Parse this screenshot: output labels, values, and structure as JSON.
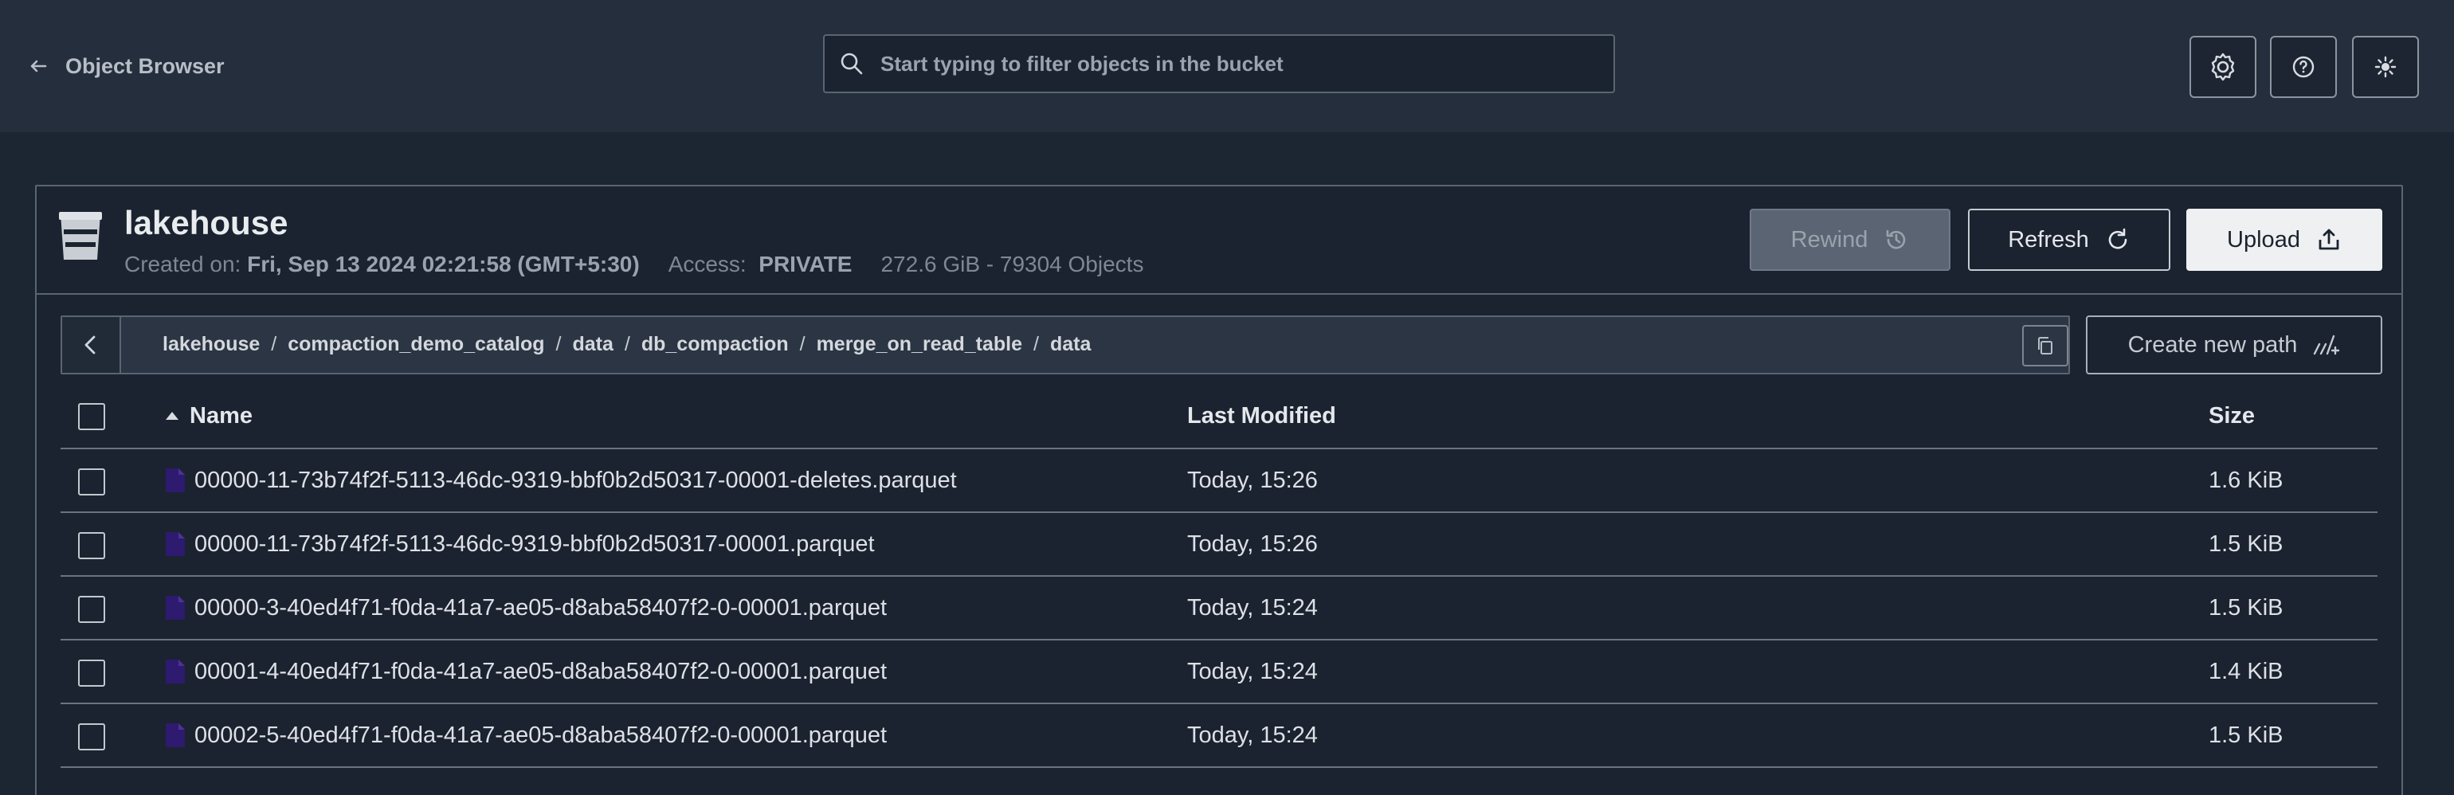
{
  "header": {
    "back_label": "Object Browser",
    "search_placeholder": "Start typing to filter objects in the bucket",
    "icons": [
      "settings-icon",
      "help-icon",
      "theme-toggle-icon"
    ]
  },
  "bucket": {
    "name": "lakehouse",
    "created_label": "Created on:",
    "created_value": "Fri, Sep 13 2024 02:21:58 (GMT+5:30)",
    "access_label": "Access:",
    "access_value": "PRIVATE",
    "usage": "272.6 GiB - 79304 Objects"
  },
  "actions": {
    "rewind": "Rewind",
    "refresh": "Refresh",
    "upload": "Upload",
    "create_path": "Create new path"
  },
  "breadcrumb": [
    "lakehouse",
    "compaction_demo_catalog",
    "data",
    "db_compaction",
    "merge_on_read_table",
    "data"
  ],
  "table": {
    "columns": {
      "name": "Name",
      "modified": "Last Modified",
      "size": "Size"
    },
    "rows": [
      {
        "name": "00000-11-73b74f2f-5113-46dc-9319-bbf0b2d50317-00001-deletes.parquet",
        "modified": "Today, 15:26",
        "size": "1.6 KiB"
      },
      {
        "name": "00000-11-73b74f2f-5113-46dc-9319-bbf0b2d50317-00001.parquet",
        "modified": "Today, 15:26",
        "size": "1.5 KiB"
      },
      {
        "name": "00000-3-40ed4f71-f0da-41a7-ae05-d8aba58407f2-0-00001.parquet",
        "modified": "Today, 15:24",
        "size": "1.5 KiB"
      },
      {
        "name": "00001-4-40ed4f71-f0da-41a7-ae05-d8aba58407f2-0-00001.parquet",
        "modified": "Today, 15:24",
        "size": "1.4 KiB"
      },
      {
        "name": "00002-5-40ed4f71-f0da-41a7-ae05-d8aba58407f2-0-00001.parquet",
        "modified": "Today, 15:24",
        "size": "1.5 KiB"
      }
    ]
  },
  "colors": {
    "background": "#1c2532",
    "header": "#252e3c",
    "file_icon": "#2e1a6e",
    "upload_button": "#eef0f2"
  }
}
